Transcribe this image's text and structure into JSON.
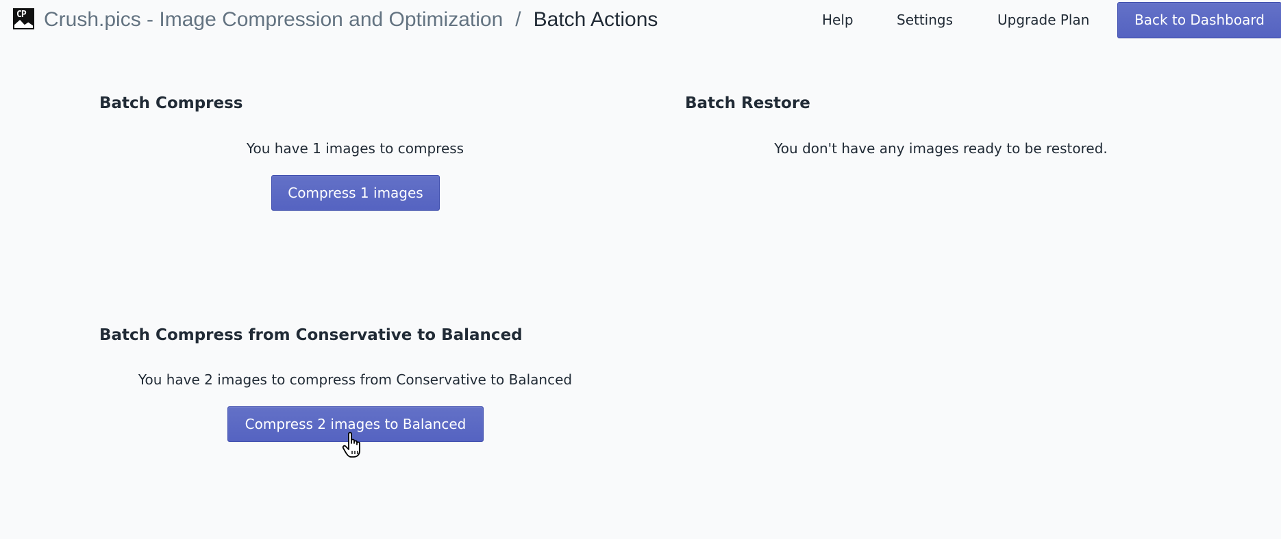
{
  "header": {
    "logo_text": "CP",
    "app_title": "Crush.pics - Image Compression and Optimization",
    "separator": "/",
    "page_title": "Batch Actions",
    "nav": {
      "help": "Help",
      "settings": "Settings",
      "upgrade": "Upgrade Plan"
    },
    "back_button": "Back to Dashboard"
  },
  "batch_compress": {
    "title": "Batch Compress",
    "message": "You have 1 images to compress",
    "button": "Compress 1 images"
  },
  "batch_restore": {
    "title": "Batch Restore",
    "message": "You don't have any images ready to be restored."
  },
  "batch_balanced": {
    "title": "Batch Compress from Conservative to Balanced",
    "message": "You have 2 images to compress from Conservative to Balanced",
    "button": "Compress 2 images to Balanced"
  },
  "colors": {
    "primary": "#5c6ac4",
    "background": "#f9fafb",
    "text": "#212b36",
    "muted": "#637381"
  }
}
